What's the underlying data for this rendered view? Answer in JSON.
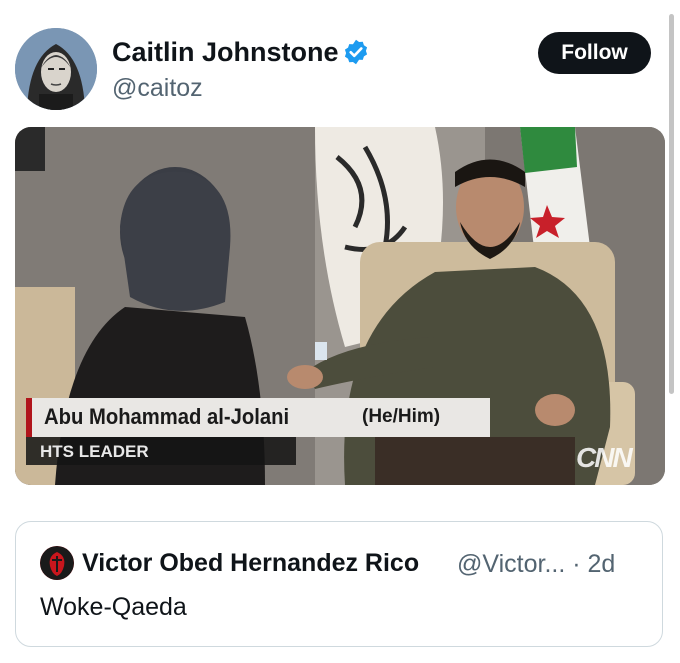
{
  "author": {
    "name": "Caitlin Johnstone",
    "handle": "@caitoz",
    "verified_icon": "verified-badge-icon",
    "verified_color": "#1d9bf0"
  },
  "follow_button": {
    "label": "Follow"
  },
  "media": {
    "lower_third_name": "Abu Mohammad al-Jolani",
    "lower_third_pronoun": "(He/Him)",
    "lower_third_title": "HTS LEADER",
    "network_logo": "CNN"
  },
  "quoted_post": {
    "name": "Victor Obed Hernandez Rico",
    "handle_time": "@Victor... · 2d",
    "text": "Woke-Qaeda"
  },
  "colors": {
    "text_primary": "#0f1419",
    "text_secondary": "#536471",
    "border": "#cfd9de",
    "accent_red": "#b0141b"
  }
}
